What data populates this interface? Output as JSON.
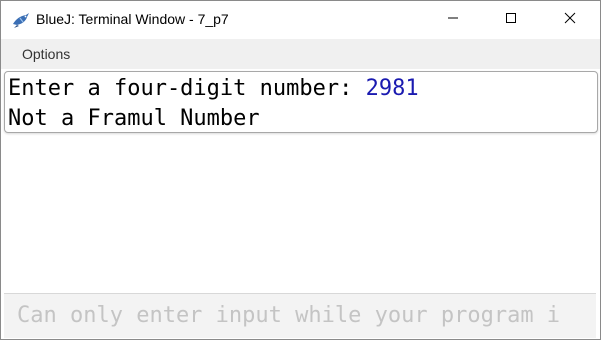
{
  "window": {
    "title": "BlueJ: Terminal Window - 7_p7",
    "icon": "bluej-bird-icon",
    "controls": {
      "minimize": "minimize-icon",
      "maximize": "maximize-icon",
      "close": "close-icon"
    }
  },
  "menubar": {
    "items": [
      {
        "label": "Options"
      }
    ]
  },
  "terminal": {
    "lines": [
      {
        "prompt": "Enter a four-digit number: ",
        "input": "2981"
      },
      {
        "text": "Not a Framul Number"
      }
    ]
  },
  "input": {
    "placeholder": "Can only enter input while your program i"
  },
  "colors": {
    "user_input": "#1a1ab0",
    "menubar_bg": "#f0f0f0",
    "placeholder": "#c4c4c4"
  }
}
